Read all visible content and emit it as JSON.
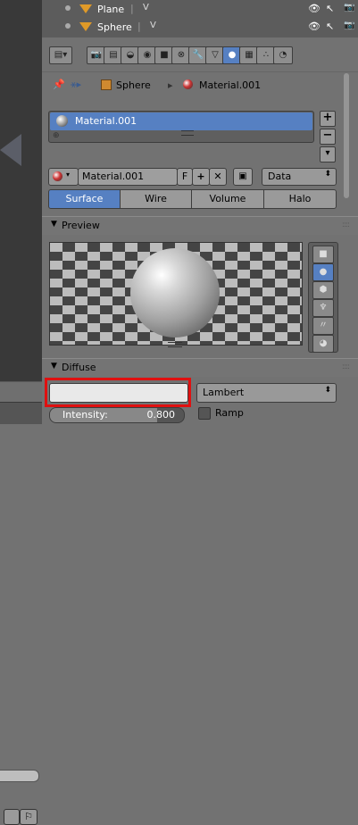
{
  "outliner": {
    "items": [
      {
        "name": "Plane",
        "sep": "|",
        "mesh_icon": "V",
        "eye": "👁",
        "cursor": "↖",
        "camera": "📷"
      },
      {
        "name": "Sphere",
        "sep": "|",
        "mesh_icon": "V",
        "eye": "👁",
        "cursor": "↖",
        "camera": "📷"
      }
    ]
  },
  "context_tabs": [
    {
      "icon": "render-icon",
      "glyph": "📷"
    },
    {
      "icon": "render-layers-icon",
      "glyph": "▤"
    },
    {
      "icon": "scene-icon",
      "glyph": "◒"
    },
    {
      "icon": "world-icon",
      "glyph": "◉"
    },
    {
      "icon": "object-icon",
      "glyph": "■"
    },
    {
      "icon": "constraints-icon",
      "glyph": "⊗"
    },
    {
      "icon": "modifiers-icon",
      "glyph": "🔧"
    },
    {
      "icon": "data-icon",
      "glyph": "▽"
    },
    {
      "icon": "material-icon",
      "glyph": "●"
    },
    {
      "icon": "texture-icon",
      "glyph": "▦"
    },
    {
      "icon": "particles-icon",
      "glyph": "∴"
    },
    {
      "icon": "physics-icon",
      "glyph": "◔"
    }
  ],
  "breadcrumb": {
    "object": "Sphere",
    "material": "Material.001"
  },
  "material_slots": {
    "items": [
      "Material.001"
    ],
    "add_label": "+",
    "remove_label": "−",
    "menu_label": "▾"
  },
  "datablock": {
    "name": "Material.001",
    "fake_user_label": "F",
    "new_label": "+",
    "unlink_label": "✕",
    "link_options": [
      "Data"
    ],
    "link_selected": "Data"
  },
  "material_types": {
    "tabs": [
      "Surface",
      "Wire",
      "Volume",
      "Halo"
    ],
    "active": "Surface"
  },
  "preview_panel": {
    "title": "Preview"
  },
  "diffuse_panel": {
    "title": "Diffuse",
    "color": "#e9e9e9",
    "shader_options": [
      "Lambert"
    ],
    "shader_selected": "Lambert",
    "intensity_label": "Intensity:",
    "intensity_value": "0.800",
    "intensity_fraction": 0.8,
    "ramp_label": "Ramp"
  },
  "colors": {
    "accent": "#5680c2",
    "highlight": "#e01010"
  }
}
